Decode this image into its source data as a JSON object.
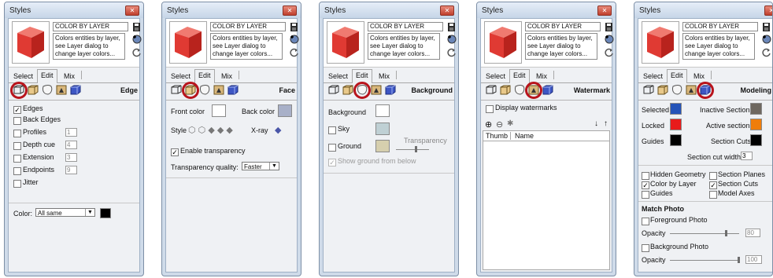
{
  "colors": {
    "edge_red": "#e03a33",
    "circle": "#b8141c",
    "front_swatch": "#ffffff",
    "back_swatch": "#a8b0c8",
    "sky": "#bfd0d4",
    "ground": "#d6cfae",
    "background": "#ffffff",
    "selected": "#2453b8",
    "locked": "#e81b1b",
    "guides": "#000000",
    "inactive": "#6e6860",
    "active": "#ef7d0a",
    "section_cuts": "#000000",
    "edge_color": "#000000"
  },
  "panels": [
    {
      "title": "Styles",
      "style_name": "COLOR BY LAYER",
      "description": "Colors entities by layer, see Layer dialog to change layer colors...",
      "tabs": [
        "Select",
        "Edit",
        "Mix"
      ],
      "section": "Edge"
    },
    {
      "title": "Styles",
      "style_name": "COLOR BY LAYER",
      "description": "Colors entities by layer, see Layer dialog to change layer colors...",
      "tabs": [
        "Select",
        "Edit",
        "Mix"
      ],
      "section": "Face"
    },
    {
      "title": "Styles",
      "style_name": "COLOR BY LAYER",
      "description": "Colors entities by layer, see Layer dialog to change layer colors...",
      "tabs": [
        "Select",
        "Edit",
        "Mix"
      ],
      "section": "Background"
    },
    {
      "title": "Styles",
      "style_name": "COLOR BY LAYER",
      "description": "Colors entities by layer, see Layer dialog to change layer colors...",
      "tabs": [
        "Select",
        "Edit",
        "Mix"
      ],
      "section": "Watermark"
    },
    {
      "title": "Styles",
      "style_name": "COLOR BY LAYER",
      "description": "Colors entities by layer, see Layer dialog to change layer colors...",
      "tabs": [
        "Select",
        "Edit",
        "Mix"
      ],
      "section": "Modeling"
    }
  ],
  "edge": {
    "edges": "Edges",
    "back_edges": "Back Edges",
    "profiles": "Profiles",
    "profiles_val": "1",
    "depth_cue": "Depth cue",
    "depth_cue_val": "4",
    "extension": "Extension",
    "extension_val": "3",
    "endpoints": "Endpoints",
    "endpoints_val": "9",
    "jitter": "Jitter",
    "color_label": "Color:",
    "color_value": "All same"
  },
  "face": {
    "front_color": "Front color",
    "back_color": "Back color",
    "style_label": "Style",
    "xray": "X-ray",
    "enable_transparency": "Enable transparency",
    "transparency_quality": "Transparency quality:",
    "quality_value": "Faster"
  },
  "background": {
    "background": "Background",
    "sky": "Sky",
    "ground": "Ground",
    "transparency": "Transparency",
    "show_ground": "Show ground from below"
  },
  "watermark": {
    "display": "Display watermarks",
    "thumb_col": "Thumb",
    "name_col": "Name"
  },
  "modeling": {
    "selected": "Selected",
    "inactive_section": "Inactive Section",
    "locked": "Locked",
    "active_section": "Active section",
    "guides": "Guides",
    "section_cuts": "Section Cuts",
    "section_cut_width": "Section cut width",
    "section_cut_width_val": "3",
    "hidden_geometry": "Hidden Geometry",
    "section_planes": "Section Planes",
    "color_by_layer": "Color by Layer",
    "section_cuts_cb": "Section Cuts",
    "guides_cb": "Guides",
    "model_axes": "Model Axes",
    "match_photo": "Match Photo",
    "foreground_photo": "Foreground Photo",
    "opacity": "Opacity",
    "fg_opacity": "80",
    "background_photo": "Background Photo",
    "bg_opacity": "100"
  }
}
